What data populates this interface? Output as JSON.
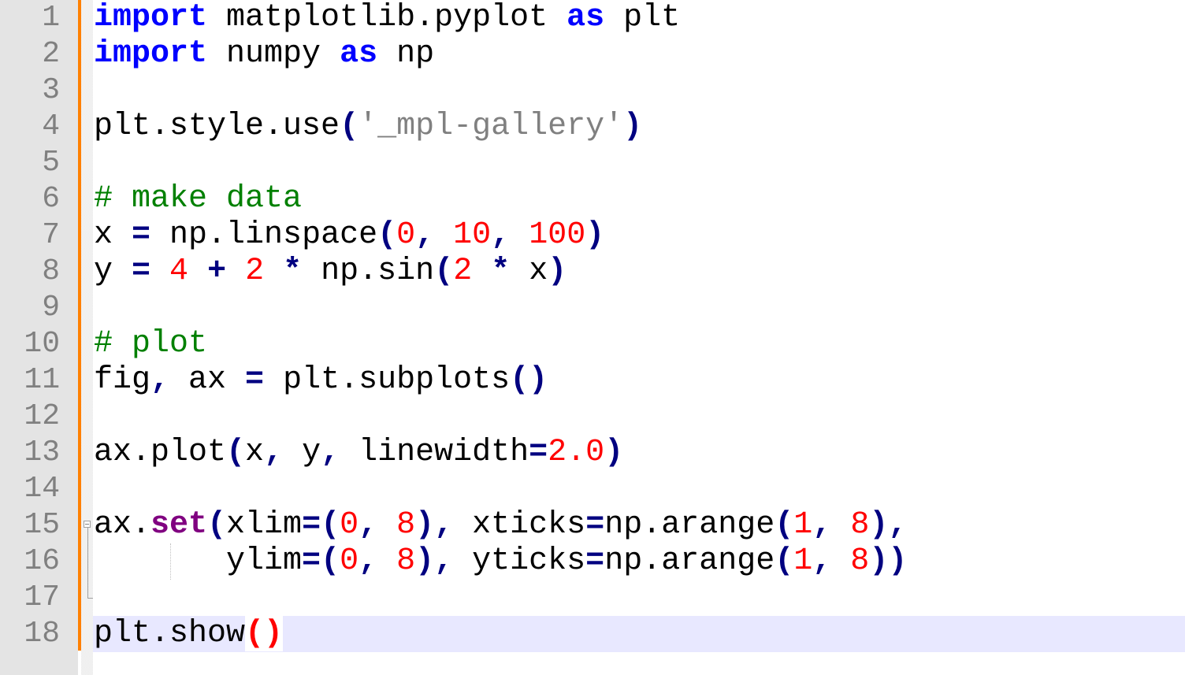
{
  "editor": {
    "current_line": 18,
    "colors": {
      "keyword": "#0000ff",
      "builtin_method": "#800080",
      "operator": "#000080",
      "number": "#ff0000",
      "string": "#808080",
      "comment": "#008000",
      "change_bar": "#ff8000",
      "current_line_bg": "#e8e8ff"
    },
    "lines": [
      {
        "num": "1",
        "tokens": [
          [
            "kw",
            "import"
          ],
          [
            "id",
            " matplotlib.pyplot "
          ],
          [
            "kw",
            "as"
          ],
          [
            "id",
            " plt"
          ]
        ]
      },
      {
        "num": "2",
        "tokens": [
          [
            "kw",
            "import"
          ],
          [
            "id",
            " numpy "
          ],
          [
            "kw",
            "as"
          ],
          [
            "id",
            " np"
          ]
        ]
      },
      {
        "num": "3",
        "tokens": []
      },
      {
        "num": "4",
        "tokens": [
          [
            "id",
            "plt.style.use"
          ],
          [
            "op",
            "("
          ],
          [
            "str",
            "'_mpl-gallery'"
          ],
          [
            "op",
            ")"
          ]
        ]
      },
      {
        "num": "5",
        "tokens": []
      },
      {
        "num": "6",
        "tokens": [
          [
            "cmt",
            "# make data"
          ]
        ]
      },
      {
        "num": "7",
        "tokens": [
          [
            "id",
            "x "
          ],
          [
            "op",
            "="
          ],
          [
            "id",
            " np.linspace"
          ],
          [
            "op",
            "("
          ],
          [
            "num",
            "0"
          ],
          [
            "op",
            ","
          ],
          [
            "id",
            " "
          ],
          [
            "num",
            "10"
          ],
          [
            "op",
            ","
          ],
          [
            "id",
            " "
          ],
          [
            "num",
            "100"
          ],
          [
            "op",
            ")"
          ]
        ]
      },
      {
        "num": "8",
        "tokens": [
          [
            "id",
            "y "
          ],
          [
            "op",
            "="
          ],
          [
            "id",
            " "
          ],
          [
            "num",
            "4"
          ],
          [
            "id",
            " "
          ],
          [
            "op",
            "+"
          ],
          [
            "id",
            " "
          ],
          [
            "num",
            "2"
          ],
          [
            "id",
            " "
          ],
          [
            "op",
            "*"
          ],
          [
            "id",
            " np.sin"
          ],
          [
            "op",
            "("
          ],
          [
            "num",
            "2"
          ],
          [
            "id",
            " "
          ],
          [
            "op",
            "*"
          ],
          [
            "id",
            " x"
          ],
          [
            "op",
            ")"
          ]
        ]
      },
      {
        "num": "9",
        "tokens": []
      },
      {
        "num": "10",
        "tokens": [
          [
            "cmt",
            "# plot"
          ]
        ]
      },
      {
        "num": "11",
        "tokens": [
          [
            "id",
            "fig"
          ],
          [
            "op",
            ","
          ],
          [
            "id",
            " ax "
          ],
          [
            "op",
            "="
          ],
          [
            "id",
            " plt.subplots"
          ],
          [
            "op",
            "()"
          ]
        ]
      },
      {
        "num": "12",
        "tokens": []
      },
      {
        "num": "13",
        "tokens": [
          [
            "id",
            "ax.plot"
          ],
          [
            "op",
            "("
          ],
          [
            "id",
            "x"
          ],
          [
            "op",
            ","
          ],
          [
            "id",
            " y"
          ],
          [
            "op",
            ","
          ],
          [
            "id",
            " linewidth"
          ],
          [
            "op",
            "="
          ],
          [
            "num",
            "2.0"
          ],
          [
            "op",
            ")"
          ]
        ]
      },
      {
        "num": "14",
        "tokens": []
      },
      {
        "num": "15",
        "tokens": [
          [
            "id",
            "ax."
          ],
          [
            "kw2",
            "set"
          ],
          [
            "op",
            "("
          ],
          [
            "id",
            "xlim"
          ],
          [
            "op",
            "=("
          ],
          [
            "num",
            "0"
          ],
          [
            "op",
            ","
          ],
          [
            "id",
            " "
          ],
          [
            "num",
            "8"
          ],
          [
            "op",
            "),"
          ],
          [
            "id",
            " xticks"
          ],
          [
            "op",
            "="
          ],
          [
            "id",
            "np.arange"
          ],
          [
            "op",
            "("
          ],
          [
            "num",
            "1"
          ],
          [
            "op",
            ","
          ],
          [
            "id",
            " "
          ],
          [
            "num",
            "8"
          ],
          [
            "op",
            "),"
          ]
        ]
      },
      {
        "num": "16",
        "tokens": [
          [
            "id",
            "       ylim"
          ],
          [
            "op",
            "=("
          ],
          [
            "num",
            "0"
          ],
          [
            "op",
            ","
          ],
          [
            "id",
            " "
          ],
          [
            "num",
            "8"
          ],
          [
            "op",
            "),"
          ],
          [
            "id",
            " yticks"
          ],
          [
            "op",
            "="
          ],
          [
            "id",
            "np.arange"
          ],
          [
            "op",
            "("
          ],
          [
            "num",
            "1"
          ],
          [
            "op",
            ","
          ],
          [
            "id",
            " "
          ],
          [
            "num",
            "8"
          ],
          [
            "op",
            "))"
          ]
        ]
      },
      {
        "num": "17",
        "tokens": []
      },
      {
        "num": "18",
        "tokens": [
          [
            "id",
            "plt.show"
          ],
          [
            "brace",
            "()"
          ]
        ]
      }
    ]
  }
}
